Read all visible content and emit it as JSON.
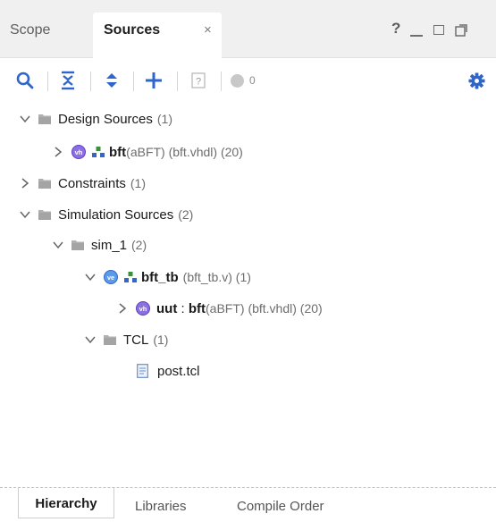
{
  "tabs": {
    "scope": "Scope",
    "sources": "Sources",
    "close": "×",
    "help": "?"
  },
  "toolbar": {
    "search_icon": "search-icon",
    "collapse_icon": "collapse-all-icon",
    "expand_icon": "expand-all-icon",
    "add_icon": "add-icon",
    "properties_icon": "properties-icon",
    "status_count": "0",
    "settings_icon": "gear-icon"
  },
  "tree": {
    "design_sources": {
      "label": "Design Sources",
      "count": "(1)"
    },
    "bft": {
      "name": "bft",
      "detail": "(aBFT) (bft.vhdl) (20)"
    },
    "constraints": {
      "label": "Constraints",
      "count": "(1)"
    },
    "simulation_sources": {
      "label": "Simulation Sources",
      "count": "(2)"
    },
    "sim_1": {
      "label": "sim_1",
      "count": "(2)"
    },
    "bft_tb": {
      "name": "bft_tb",
      "detail": "(bft_tb.v) (1)"
    },
    "uut": {
      "name": "uut",
      "sep": " : ",
      "entity": "bft",
      "detail": "(aBFT) (bft.vhdl) (20)"
    },
    "tcl": {
      "label": "TCL",
      "count": "(1)"
    },
    "post_tcl": {
      "label": "post.tcl"
    }
  },
  "bottom_tabs": {
    "hierarchy": "Hierarchy",
    "libraries": "Libraries",
    "compile_order": "Compile Order"
  },
  "colors": {
    "accent_blue": "#2f66c9",
    "vhdl_badge": "#6a4fc9",
    "verilog_badge": "#3d7ad6",
    "folder_gray": "#a0a0a0",
    "status_dot": "#c8c8c8"
  }
}
